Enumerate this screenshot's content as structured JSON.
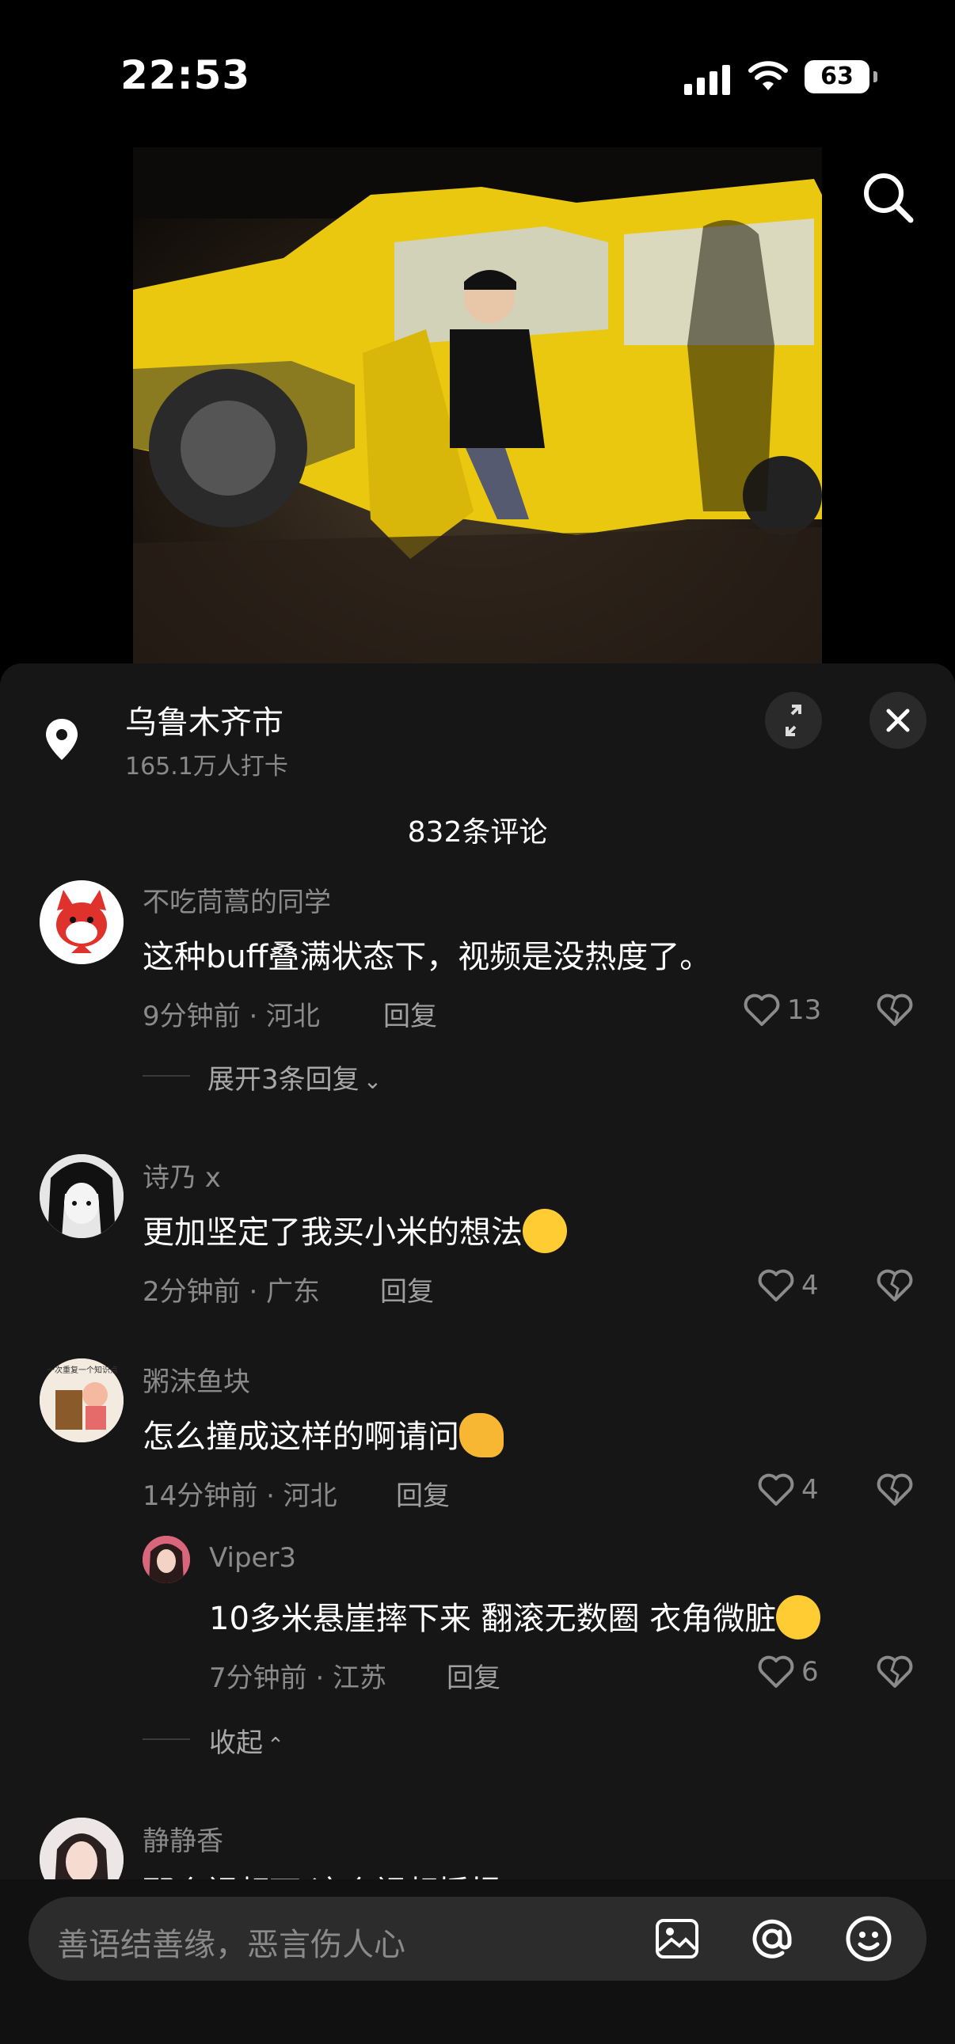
{
  "status_bar": {
    "time": "22:53",
    "battery": "63"
  },
  "location": {
    "title": "乌鲁木齐市",
    "subtitle": "165.1万人打卡"
  },
  "comments_header": {
    "count_label": "832条评论"
  },
  "comments": [
    {
      "user": "不吃茼蒿的同学",
      "text": "这种buff叠满状态下，视频是没热度了。",
      "meta": "9分钟前 · 河北",
      "reply": "回复",
      "likes": "13",
      "expand": "展开3条回复"
    },
    {
      "user": "诗乃 x",
      "text": "更加坚定了我买小米的想法",
      "meta": "2分钟前 · 广东",
      "reply": "回复",
      "likes": "4"
    },
    {
      "user": "粥沫鱼块",
      "text": "怎么撞成这样的啊请问",
      "meta": "14分钟前 · 河北",
      "reply": "回复",
      "likes": "4",
      "avatar_caption": "一次重复一个知识点"
    },
    {
      "user": "静静香",
      "text": "那个视频下 这个视频播报"
    }
  ],
  "sub_reply": {
    "user": "Viper3",
    "text": "10多米悬崖摔下来 翻滚无数圈 衣角微脏",
    "meta": "7分钟前 · 江苏",
    "reply": "回复",
    "likes": "6",
    "collapse": "收起"
  },
  "input": {
    "placeholder": "善语结善缘，恶言伤人心"
  },
  "colors": {
    "accent_yellow": "#f2d21a",
    "sheet_bg": "#161616",
    "muted_text": "#8a8a8a"
  }
}
